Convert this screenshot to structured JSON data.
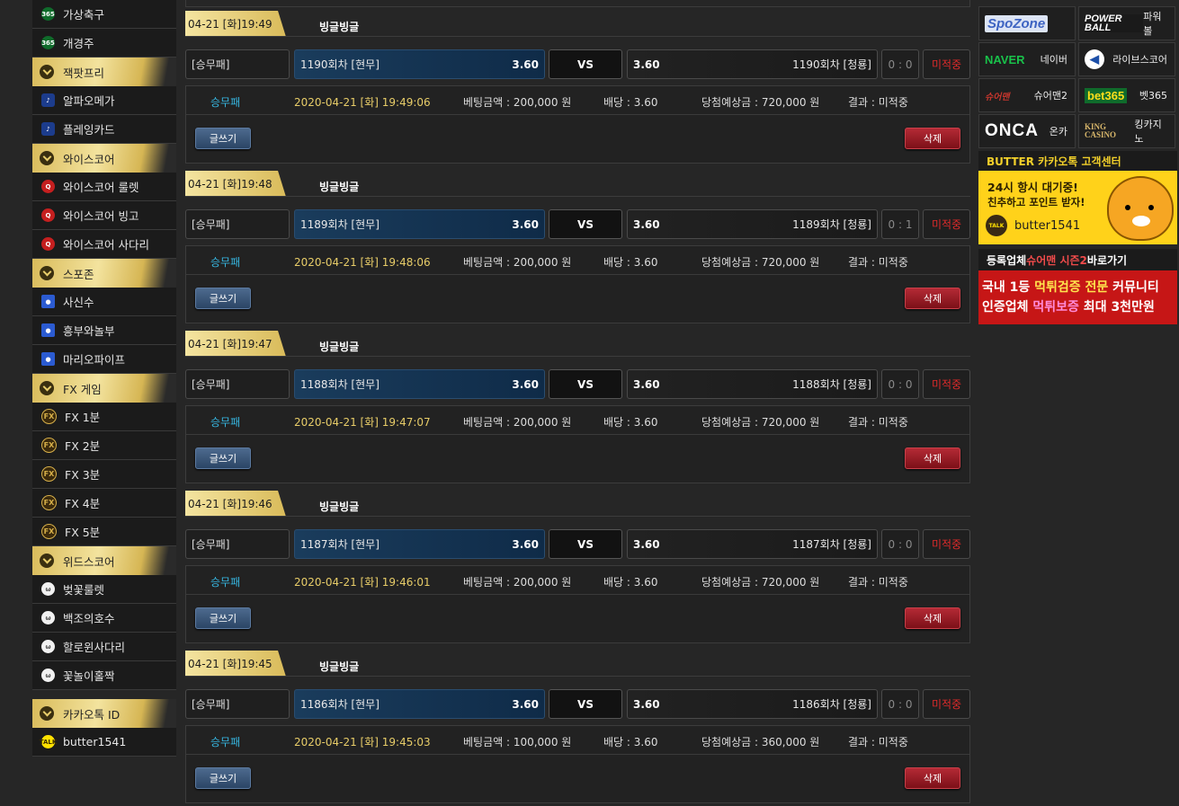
{
  "sidebar": {
    "items": [
      {
        "kind": "item",
        "label": "가상축구",
        "icon": "bet365-icon",
        "iconText": "365",
        "iconClass": "ic-365"
      },
      {
        "kind": "item",
        "label": "개경주",
        "icon": "bet365-icon",
        "iconText": "365",
        "iconClass": "ic-365"
      },
      {
        "kind": "head",
        "label": "잭팟프리"
      },
      {
        "kind": "item",
        "label": "알파오메가",
        "icon": "game-icon",
        "iconText": "♪",
        "iconClass": "ic-pb"
      },
      {
        "kind": "item",
        "label": "플레잉카드",
        "icon": "game-icon",
        "iconText": "♪",
        "iconClass": "ic-pb"
      },
      {
        "kind": "head",
        "label": "와이스코어"
      },
      {
        "kind": "item",
        "label": "와이스코어 룰렛",
        "icon": "wisescore-icon",
        "iconText": "Q",
        "iconClass": "ic-ws"
      },
      {
        "kind": "item",
        "label": "와이스코어 빙고",
        "icon": "wisescore-icon",
        "iconText": "Q",
        "iconClass": "ic-ws"
      },
      {
        "kind": "item",
        "label": "와이스코어 사다리",
        "icon": "wisescore-icon",
        "iconText": "Q",
        "iconClass": "ic-ws"
      },
      {
        "kind": "head",
        "label": "스포존"
      },
      {
        "kind": "item",
        "label": "사신수",
        "icon": "spozone-icon",
        "iconText": "●",
        "iconClass": "ic-sp"
      },
      {
        "kind": "item",
        "label": "흥부와놀부",
        "icon": "spozone-icon",
        "iconText": "●",
        "iconClass": "ic-sp"
      },
      {
        "kind": "item",
        "label": "마리오파이프",
        "icon": "spozone-icon",
        "iconText": "●",
        "iconClass": "ic-sp"
      },
      {
        "kind": "head",
        "label": "FX 게임"
      },
      {
        "kind": "item",
        "label": "FX 1분",
        "icon": "fx-icon",
        "iconText": "FX",
        "iconClass": "ic-fx"
      },
      {
        "kind": "item",
        "label": "FX 2분",
        "icon": "fx-icon",
        "iconText": "FX",
        "iconClass": "ic-fx"
      },
      {
        "kind": "item",
        "label": "FX 3분",
        "icon": "fx-icon",
        "iconText": "FX",
        "iconClass": "ic-fx"
      },
      {
        "kind": "item",
        "label": "FX 4분",
        "icon": "fx-icon",
        "iconText": "FX",
        "iconClass": "ic-fx"
      },
      {
        "kind": "item",
        "label": "FX 5분",
        "icon": "fx-icon",
        "iconText": "FX",
        "iconClass": "ic-fx"
      },
      {
        "kind": "head",
        "label": "위드스코어"
      },
      {
        "kind": "item",
        "label": "벚꽃룰렛",
        "icon": "withscore-icon",
        "iconText": "ω",
        "iconClass": "ic-wd"
      },
      {
        "kind": "item",
        "label": "백조의호수",
        "icon": "withscore-icon",
        "iconText": "ω",
        "iconClass": "ic-wd"
      },
      {
        "kind": "item",
        "label": "할로윈사다리",
        "icon": "withscore-icon",
        "iconText": "ω",
        "iconClass": "ic-wd"
      },
      {
        "kind": "item",
        "label": "꽃놀이홀짝",
        "icon": "withscore-icon",
        "iconText": "ω",
        "iconClass": "ic-wd"
      },
      {
        "kind": "gap"
      },
      {
        "kind": "head",
        "label": "카카오톡 ID"
      },
      {
        "kind": "item",
        "label": "butter1541",
        "icon": "kakaotalk-icon",
        "iconText": "TALK",
        "iconClass": "ic-kt"
      }
    ]
  },
  "labels": {
    "vs": "VS",
    "write_button": "글쓰기",
    "delete_button": "삭제"
  },
  "bets": [
    {
      "date": "04-21 [화]19:49",
      "nick": "빙글빙글",
      "type": "[승무패]",
      "home": "1190회차 [현무]",
      "home_odds": "3.60",
      "away_odds": "3.60",
      "away": "1190회차 [청룡]",
      "score": "0 : 0",
      "status": "미적중",
      "detail": {
        "type": "승무패",
        "datetime": "2020-04-21 [화] 19:49:06",
        "amount": "베팅금액 : 200,000 원",
        "odds": "배당 : 3.60",
        "win": "당첨예상금 : 720,000 원",
        "result": "결과 : 미적중"
      }
    },
    {
      "date": "04-21 [화]19:48",
      "nick": "빙글빙글",
      "type": "[승무패]",
      "home": "1189회차 [현무]",
      "home_odds": "3.60",
      "away_odds": "3.60",
      "away": "1189회차 [청룡]",
      "score": "0 : 1",
      "status": "미적중",
      "detail": {
        "type": "승무패",
        "datetime": "2020-04-21 [화] 19:48:06",
        "amount": "베팅금액 : 200,000 원",
        "odds": "배당 : 3.60",
        "win": "당첨예상금 : 720,000 원",
        "result": "결과 : 미적중"
      }
    },
    {
      "date": "04-21 [화]19:47",
      "nick": "빙글빙글",
      "type": "[승무패]",
      "home": "1188회차 [현무]",
      "home_odds": "3.60",
      "away_odds": "3.60",
      "away": "1188회차 [청룡]",
      "score": "0 : 0",
      "status": "미적중",
      "detail": {
        "type": "승무패",
        "datetime": "2020-04-21 [화] 19:47:07",
        "amount": "베팅금액 : 200,000 원",
        "odds": "배당 : 3.60",
        "win": "당첨예상금 : 720,000 원",
        "result": "결과 : 미적중"
      }
    },
    {
      "date": "04-21 [화]19:46",
      "nick": "빙글빙글",
      "type": "[승무패]",
      "home": "1187회차 [현무]",
      "home_odds": "3.60",
      "away_odds": "3.60",
      "away": "1187회차 [청룡]",
      "score": "0 : 0",
      "status": "미적중",
      "detail": {
        "type": "승무패",
        "datetime": "2020-04-21 [화] 19:46:01",
        "amount": "베팅금액 : 200,000 원",
        "odds": "배당 : 3.60",
        "win": "당첨예상금 : 720,000 원",
        "result": "결과 : 미적중"
      }
    },
    {
      "date": "04-21 [화]19:45",
      "nick": "빙글빙글",
      "type": "[승무패]",
      "home": "1186회차 [현무]",
      "home_odds": "3.60",
      "away_odds": "3.60",
      "away": "1186회차 [청룡]",
      "score": "0 : 0",
      "status": "미적중",
      "detail": {
        "type": "승무패",
        "datetime": "2020-04-21 [화] 19:45:03",
        "amount": "베팅금액 : 100,000 원",
        "odds": "배당 : 3.60",
        "win": "당첨예상금 : 360,000 원",
        "result": "결과 : 미적중"
      }
    }
  ],
  "partners": [
    {
      "logo": "SpoZone",
      "logoClass": "lg-spo",
      "label": "",
      "name": "spozone"
    },
    {
      "logo": "POWER BALL",
      "logoClass": "lg-pb",
      "label": "파워볼",
      "name": "powerball"
    },
    {
      "logo": "NAVER",
      "logoClass": "lg-naver",
      "label": "네이버",
      "name": "naver"
    },
    {
      "logo": "◀",
      "logoClass": "lg-live",
      "label": "라이브스코어",
      "name": "livescore"
    },
    {
      "logo": "슈어맨",
      "logoClass": "lg-sure",
      "label": "슈어맨2",
      "name": "sureman"
    },
    {
      "logo": "bet365",
      "logoClass": "lg-bet365",
      "label": "벳365",
      "name": "bet365"
    },
    {
      "logo": "ONCA",
      "logoClass": "lg-onca",
      "label": "온카",
      "name": "onca"
    },
    {
      "logo": "KING CASINO",
      "logoClass": "lg-king",
      "label": "킹카지노",
      "name": "kingcasino"
    }
  ],
  "kakao_banner": {
    "title": "BUTTER 카카오톡 고객센터",
    "line1": "24시 항시 대기중!",
    "line2": "친추하고 포인트 받자!",
    "talk": "TALK",
    "id": "butter1541"
  },
  "reg_banner": {
    "title_prefix": "등록업체 ",
    "title_highlight": "슈어맨 시즌2",
    "title_suffix": " 바로가기",
    "l1_a": "국내 1등 ",
    "l1_b": "먹튀검증",
    "l1_c": " 전문",
    "l1_d": " 커뮤니티",
    "l2_a": "인증업체 ",
    "l2_b": "먹튀보증",
    "l2_c": " 최대 3천만원"
  },
  "colors": {
    "gold": "#e0c468",
    "status_red": "#e02a2a",
    "type_blue": "#36b6e0",
    "date_gold": "#e7cc68"
  }
}
